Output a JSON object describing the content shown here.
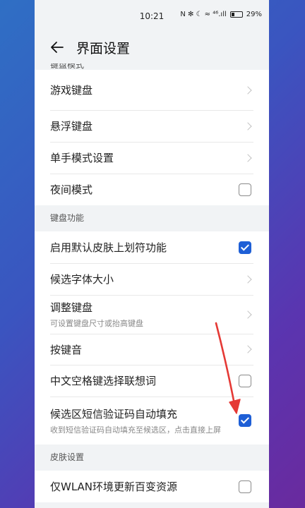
{
  "status": {
    "time": "10:21",
    "icons": "N ✻ ☾ ≈ ⁴⁶.ıll",
    "battery": "29%"
  },
  "header": {
    "title": "界面设置"
  },
  "sections": {
    "keyboard_mode": {
      "label": "键盘模式",
      "items": [
        {
          "title": "游戏键盘"
        },
        {
          "title": "悬浮键盘"
        },
        {
          "title": "单手模式设置"
        },
        {
          "title": "夜间模式",
          "checked": false
        }
      ]
    },
    "keyboard_function": {
      "label": "键盘功能",
      "items": [
        {
          "title": "启用默认皮肤上划符功能",
          "checked": true
        },
        {
          "title": "候选字体大小"
        },
        {
          "title": "调整键盘",
          "subtitle": "可设置键盘尺寸或抬高键盘"
        },
        {
          "title": "按键音"
        },
        {
          "title": "中文空格键选择联想词",
          "checked": false
        },
        {
          "title": "候选区短信验证码自动填充",
          "subtitle": "收到短信验证码自动填充至候选区，点击直接上屏",
          "checked": true
        }
      ]
    },
    "skin": {
      "label": "皮肤设置",
      "items": [
        {
          "title": "仅WLAN环境更新百变资源",
          "checked": false
        }
      ]
    }
  },
  "colors": {
    "accent": "#1e5fd6",
    "annotation_arrow": "#e53935"
  }
}
